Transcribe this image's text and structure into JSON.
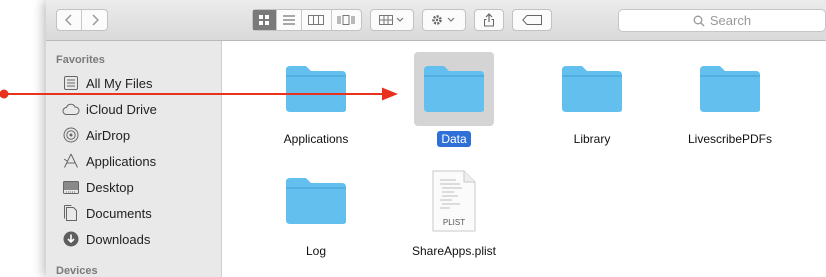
{
  "window": {
    "toolbar": {
      "nav": {
        "back_icon": "chevron-left",
        "forward_icon": "chevron-right"
      },
      "view_buttons": [
        "icon-view",
        "list-view",
        "column-view",
        "cover-flow-view"
      ],
      "arrange_icon": "arrange-grid",
      "action_icon": "gear",
      "share_icon": "share",
      "tag_icon": "tag"
    },
    "search": {
      "placeholder": "Search"
    }
  },
  "sidebar": {
    "favorites_heading": "Favorites",
    "devices_heading": "Devices",
    "items": [
      {
        "label": "All My Files",
        "icon": "all-files-icon"
      },
      {
        "label": "iCloud Drive",
        "icon": "cloud-icon"
      },
      {
        "label": "AirDrop",
        "icon": "airdrop-icon"
      },
      {
        "label": "Applications",
        "icon": "applications-icon"
      },
      {
        "label": "Desktop",
        "icon": "desktop-icon"
      },
      {
        "label": "Documents",
        "icon": "documents-icon"
      },
      {
        "label": "Downloads",
        "icon": "downloads-icon"
      }
    ]
  },
  "files": [
    {
      "name": "Applications",
      "kind": "folder",
      "selected": false
    },
    {
      "name": "Data",
      "kind": "folder",
      "selected": true
    },
    {
      "name": "Library",
      "kind": "folder",
      "selected": false
    },
    {
      "name": "LivescribePDFs",
      "kind": "folder",
      "selected": false
    },
    {
      "name": "Log",
      "kind": "folder",
      "selected": false
    },
    {
      "name": "ShareApps.plist",
      "kind": "plist",
      "selected": false,
      "badge": "PLIST"
    }
  ],
  "colors": {
    "folder": "#63c0ee",
    "selection": "#2f6fd8",
    "annotation_arrow": "#e8321e"
  }
}
